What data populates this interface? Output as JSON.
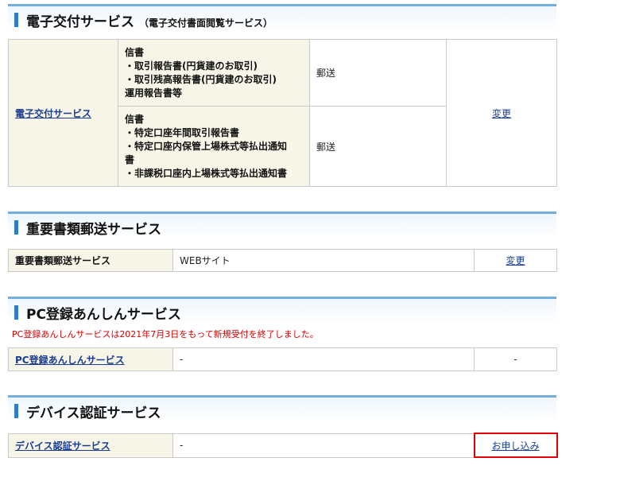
{
  "sections": {
    "electronic": {
      "title": "電子交付サービス",
      "subtitle": "（電子交付書面閲覧サービス）",
      "service_link": "電子交付サービス",
      "rows": [
        {
          "doc_lines": [
            "信書",
            "・取引報告書(円貨建のお取引)",
            "・取引残高報告書(円貨建のお取引)",
            "運用報告書等"
          ],
          "method": "郵送"
        },
        {
          "doc_lines": [
            "信書",
            "・特定口座年間取引報告書",
            "・特定口座内保管上場株式等払出通知",
            "書",
            "・非課税口座内上場株式等払出通知書"
          ],
          "method": "郵送"
        }
      ],
      "action": "変更"
    },
    "mail": {
      "title": "重要書類郵送サービス",
      "label": "重要書類郵送サービス",
      "value": "WEBサイト",
      "action": "変更"
    },
    "pc": {
      "title": "PC登録あんしんサービス",
      "notice": "PC登録あんしんサービスは2021年7月3日をもって新規受付を終了しました。",
      "label": "PC登録あんしんサービス",
      "value": "-",
      "action": "-"
    },
    "device": {
      "title": "デバイス認証サービス",
      "label": "デバイス認証サービス",
      "value": "-",
      "action": "お申し込み"
    }
  }
}
